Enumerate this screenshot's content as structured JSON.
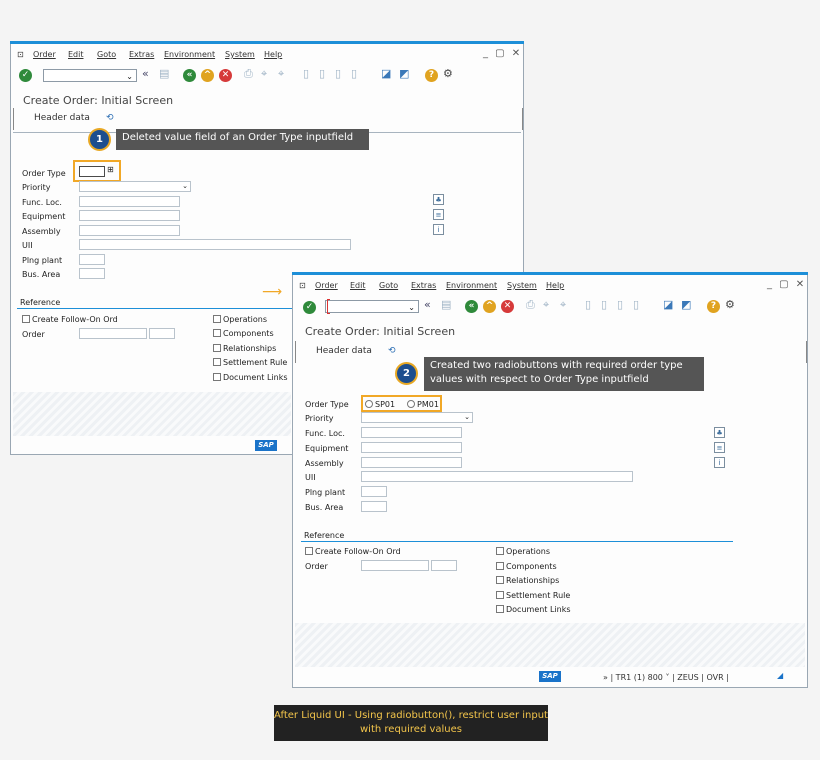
{
  "menu": [
    "Order",
    "Edit",
    "Goto",
    "Extras",
    "Environment",
    "System",
    "Help"
  ],
  "window_controls": "_ ▢ ✕",
  "screen_title": "Create Order: Initial Screen",
  "header_tab": "Header data",
  "fields": {
    "order_type": "Order Type",
    "priority": "Priority",
    "func_loc": "Func. Loc.",
    "equipment": "Equipment",
    "assembly": "Assembly",
    "uii": "UII",
    "plng_plant": "Plng plant",
    "bus_area": "Bus. Area"
  },
  "reference": {
    "title": "Reference",
    "create_follow_on": "Create Follow-On Ord",
    "order": "Order",
    "checks": [
      "Operations",
      "Components",
      "Relationships",
      "Settlement Rule",
      "Document Links"
    ]
  },
  "radio_options": [
    "SP01",
    "PM01"
  ],
  "callouts": {
    "one_num": "1",
    "one_text": "Deleted value field of an Order Type inputfield",
    "two_num": "2",
    "two_text": "Created two radiobuttons with required order type values with respect to Order Type inputfield"
  },
  "status_bar": "» | TR1 (1) 800 ˅ | ZEUS | OVR |",
  "sap_logo": "SAP",
  "caption": "After Liquid UI - Using radiobutton(), restrict user input with required values",
  "colors": {
    "accent": "#1d8fd8",
    "highlight": "#f1a827",
    "callout_bg": "#555555"
  },
  "icons": [
    "check-icon",
    "back-icon",
    "exit-icon",
    "cancel-icon",
    "print-icon",
    "find-icon",
    "help-icon",
    "settings-icon"
  ]
}
